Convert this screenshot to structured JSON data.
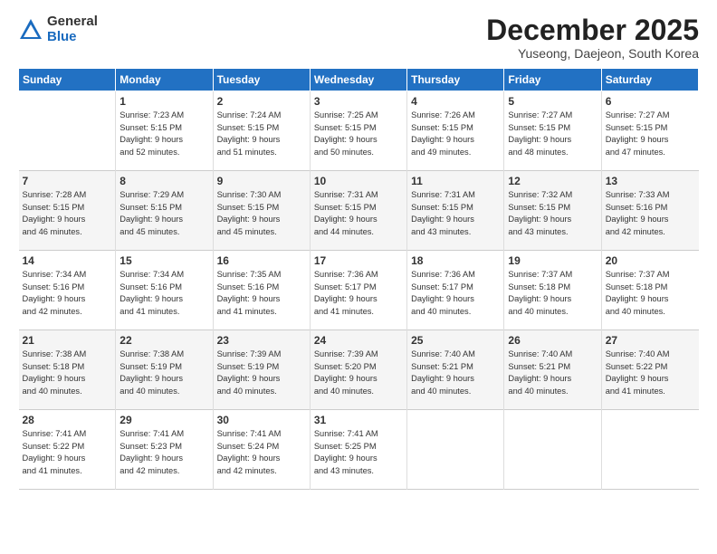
{
  "logo": {
    "general": "General",
    "blue": "Blue"
  },
  "title": "December 2025",
  "location": "Yuseong, Daejeon, South Korea",
  "days_header": [
    "Sunday",
    "Monday",
    "Tuesday",
    "Wednesday",
    "Thursday",
    "Friday",
    "Saturday"
  ],
  "weeks": [
    [
      {
        "num": "",
        "info": ""
      },
      {
        "num": "1",
        "info": "Sunrise: 7:23 AM\nSunset: 5:15 PM\nDaylight: 9 hours\nand 52 minutes."
      },
      {
        "num": "2",
        "info": "Sunrise: 7:24 AM\nSunset: 5:15 PM\nDaylight: 9 hours\nand 51 minutes."
      },
      {
        "num": "3",
        "info": "Sunrise: 7:25 AM\nSunset: 5:15 PM\nDaylight: 9 hours\nand 50 minutes."
      },
      {
        "num": "4",
        "info": "Sunrise: 7:26 AM\nSunset: 5:15 PM\nDaylight: 9 hours\nand 49 minutes."
      },
      {
        "num": "5",
        "info": "Sunrise: 7:27 AM\nSunset: 5:15 PM\nDaylight: 9 hours\nand 48 minutes."
      },
      {
        "num": "6",
        "info": "Sunrise: 7:27 AM\nSunset: 5:15 PM\nDaylight: 9 hours\nand 47 minutes."
      }
    ],
    [
      {
        "num": "7",
        "info": "Sunrise: 7:28 AM\nSunset: 5:15 PM\nDaylight: 9 hours\nand 46 minutes."
      },
      {
        "num": "8",
        "info": "Sunrise: 7:29 AM\nSunset: 5:15 PM\nDaylight: 9 hours\nand 45 minutes."
      },
      {
        "num": "9",
        "info": "Sunrise: 7:30 AM\nSunset: 5:15 PM\nDaylight: 9 hours\nand 45 minutes."
      },
      {
        "num": "10",
        "info": "Sunrise: 7:31 AM\nSunset: 5:15 PM\nDaylight: 9 hours\nand 44 minutes."
      },
      {
        "num": "11",
        "info": "Sunrise: 7:31 AM\nSunset: 5:15 PM\nDaylight: 9 hours\nand 43 minutes."
      },
      {
        "num": "12",
        "info": "Sunrise: 7:32 AM\nSunset: 5:15 PM\nDaylight: 9 hours\nand 43 minutes."
      },
      {
        "num": "13",
        "info": "Sunrise: 7:33 AM\nSunset: 5:16 PM\nDaylight: 9 hours\nand 42 minutes."
      }
    ],
    [
      {
        "num": "14",
        "info": "Sunrise: 7:34 AM\nSunset: 5:16 PM\nDaylight: 9 hours\nand 42 minutes."
      },
      {
        "num": "15",
        "info": "Sunrise: 7:34 AM\nSunset: 5:16 PM\nDaylight: 9 hours\nand 41 minutes."
      },
      {
        "num": "16",
        "info": "Sunrise: 7:35 AM\nSunset: 5:16 PM\nDaylight: 9 hours\nand 41 minutes."
      },
      {
        "num": "17",
        "info": "Sunrise: 7:36 AM\nSunset: 5:17 PM\nDaylight: 9 hours\nand 41 minutes."
      },
      {
        "num": "18",
        "info": "Sunrise: 7:36 AM\nSunset: 5:17 PM\nDaylight: 9 hours\nand 40 minutes."
      },
      {
        "num": "19",
        "info": "Sunrise: 7:37 AM\nSunset: 5:18 PM\nDaylight: 9 hours\nand 40 minutes."
      },
      {
        "num": "20",
        "info": "Sunrise: 7:37 AM\nSunset: 5:18 PM\nDaylight: 9 hours\nand 40 minutes."
      }
    ],
    [
      {
        "num": "21",
        "info": "Sunrise: 7:38 AM\nSunset: 5:18 PM\nDaylight: 9 hours\nand 40 minutes."
      },
      {
        "num": "22",
        "info": "Sunrise: 7:38 AM\nSunset: 5:19 PM\nDaylight: 9 hours\nand 40 minutes."
      },
      {
        "num": "23",
        "info": "Sunrise: 7:39 AM\nSunset: 5:19 PM\nDaylight: 9 hours\nand 40 minutes."
      },
      {
        "num": "24",
        "info": "Sunrise: 7:39 AM\nSunset: 5:20 PM\nDaylight: 9 hours\nand 40 minutes."
      },
      {
        "num": "25",
        "info": "Sunrise: 7:40 AM\nSunset: 5:21 PM\nDaylight: 9 hours\nand 40 minutes."
      },
      {
        "num": "26",
        "info": "Sunrise: 7:40 AM\nSunset: 5:21 PM\nDaylight: 9 hours\nand 40 minutes."
      },
      {
        "num": "27",
        "info": "Sunrise: 7:40 AM\nSunset: 5:22 PM\nDaylight: 9 hours\nand 41 minutes."
      }
    ],
    [
      {
        "num": "28",
        "info": "Sunrise: 7:41 AM\nSunset: 5:22 PM\nDaylight: 9 hours\nand 41 minutes."
      },
      {
        "num": "29",
        "info": "Sunrise: 7:41 AM\nSunset: 5:23 PM\nDaylight: 9 hours\nand 42 minutes."
      },
      {
        "num": "30",
        "info": "Sunrise: 7:41 AM\nSunset: 5:24 PM\nDaylight: 9 hours\nand 42 minutes."
      },
      {
        "num": "31",
        "info": "Sunrise: 7:41 AM\nSunset: 5:25 PM\nDaylight: 9 hours\nand 43 minutes."
      },
      {
        "num": "",
        "info": ""
      },
      {
        "num": "",
        "info": ""
      },
      {
        "num": "",
        "info": ""
      }
    ]
  ]
}
